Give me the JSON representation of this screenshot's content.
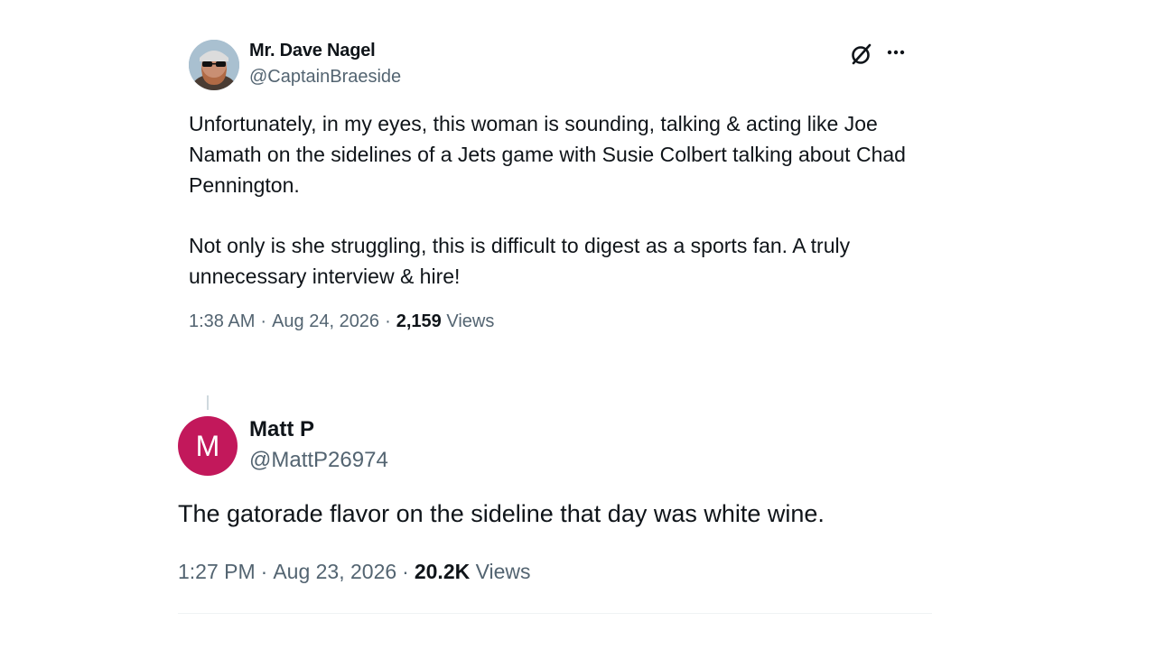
{
  "tweet1": {
    "name": "Mr. Dave Nagel",
    "handle": "@CaptainBraeside",
    "paragraphs": [
      "Unfortunately, in my eyes, this woman is sounding, talking & acting like Joe Namath on the sidelines of a Jets game with Susie Colbert talking about Chad Pennington.",
      "Not only is she struggling, this is difficult to digest as a sports fan. A truly unnecessary interview & hire!"
    ],
    "time": "1:38 AM",
    "date": "Aug 24, 2026",
    "views_count": "2,159",
    "views_label": "Views",
    "icons": [
      "grok-icon",
      "more-icon"
    ]
  },
  "tweet2": {
    "avatar_initial": "M",
    "avatar_color": "#c2185b",
    "name": "Matt P",
    "handle": "@MattP26974",
    "text": "The gatorade flavor on the sideline that day was white wine.",
    "time": "1:27 PM",
    "date": "Aug 23, 2026",
    "views_count": "20.2K",
    "views_label": "Views"
  },
  "separator": "·"
}
